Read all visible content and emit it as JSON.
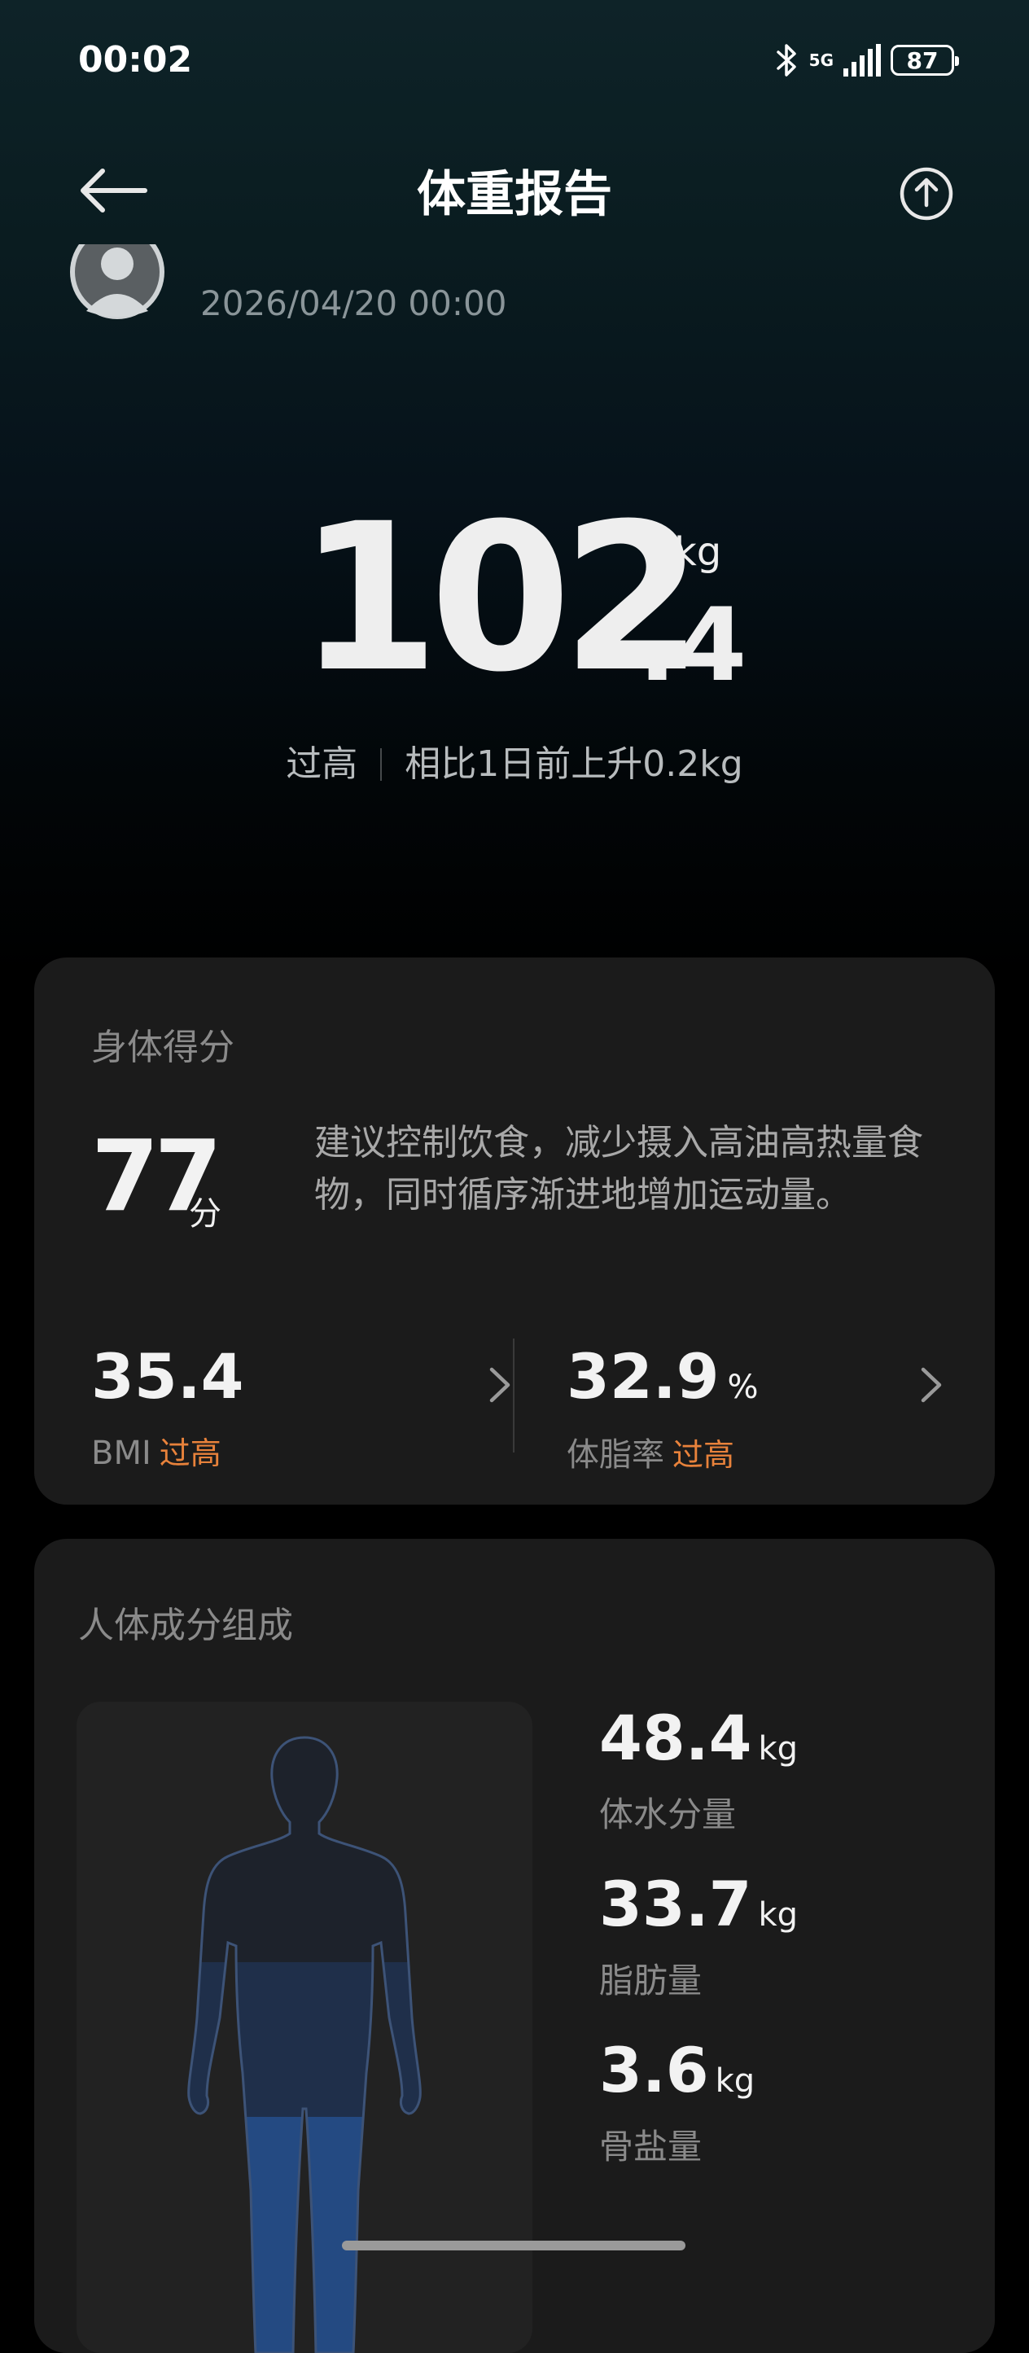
{
  "status_bar": {
    "time": "00:02",
    "network": "5G",
    "battery": "87"
  },
  "header": {
    "title": "体重报告",
    "back_icon": "arrow-left-icon",
    "share_icon": "share-upload-icon"
  },
  "profile": {
    "record_time": "2026/04/20 00:00"
  },
  "weight": {
    "integer": "102",
    "decimal": ".4",
    "unit": "kg",
    "level": "过高",
    "change": "相比1日前上升0.2kg"
  },
  "score_card": {
    "title": "身体得分",
    "score": "77",
    "score_unit": "分",
    "advice": "建议控制饮食，减少摄入高油高热量食物，同时循序渐进地增加运动量。",
    "bmi": {
      "value": "35.4",
      "label": "BMI",
      "status": "过高"
    },
    "body_fat": {
      "value": "32.9",
      "unit": "%",
      "label": "体脂率",
      "status": "过高"
    },
    "status_color": "#e8823b"
  },
  "composition_card": {
    "title": "人体成分组成",
    "items": [
      {
        "value": "48.4",
        "unit": "kg",
        "label": "体水分量"
      },
      {
        "value": "33.7",
        "unit": "kg",
        "label": "脂肪量"
      },
      {
        "value": "3.6",
        "unit": "kg",
        "label": "骨盐量"
      }
    ]
  }
}
